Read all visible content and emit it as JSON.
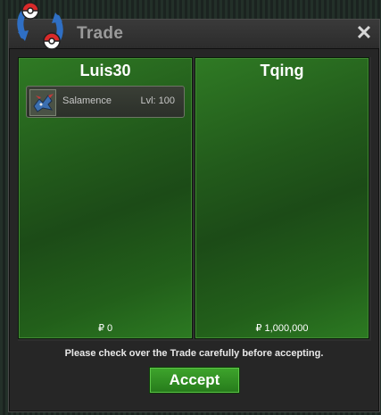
{
  "window": {
    "title": "Trade",
    "close_label": "✕"
  },
  "trade": {
    "left": {
      "name": "Luis30",
      "currency_symbol": "₽",
      "money": "0",
      "items": [
        {
          "name": "Salamence",
          "level": "Lvl: 100",
          "icon": "salamence-sprite-icon"
        }
      ]
    },
    "right": {
      "name": "Tqing",
      "currency_symbol": "₽",
      "money": "1,000,000",
      "items": []
    }
  },
  "footer": {
    "notice": "Please check over the Trade carefully before accepting.",
    "accept_label": "Accept"
  },
  "colors": {
    "panel_green": "#225a1b",
    "accept_green": "#2f8f22"
  }
}
